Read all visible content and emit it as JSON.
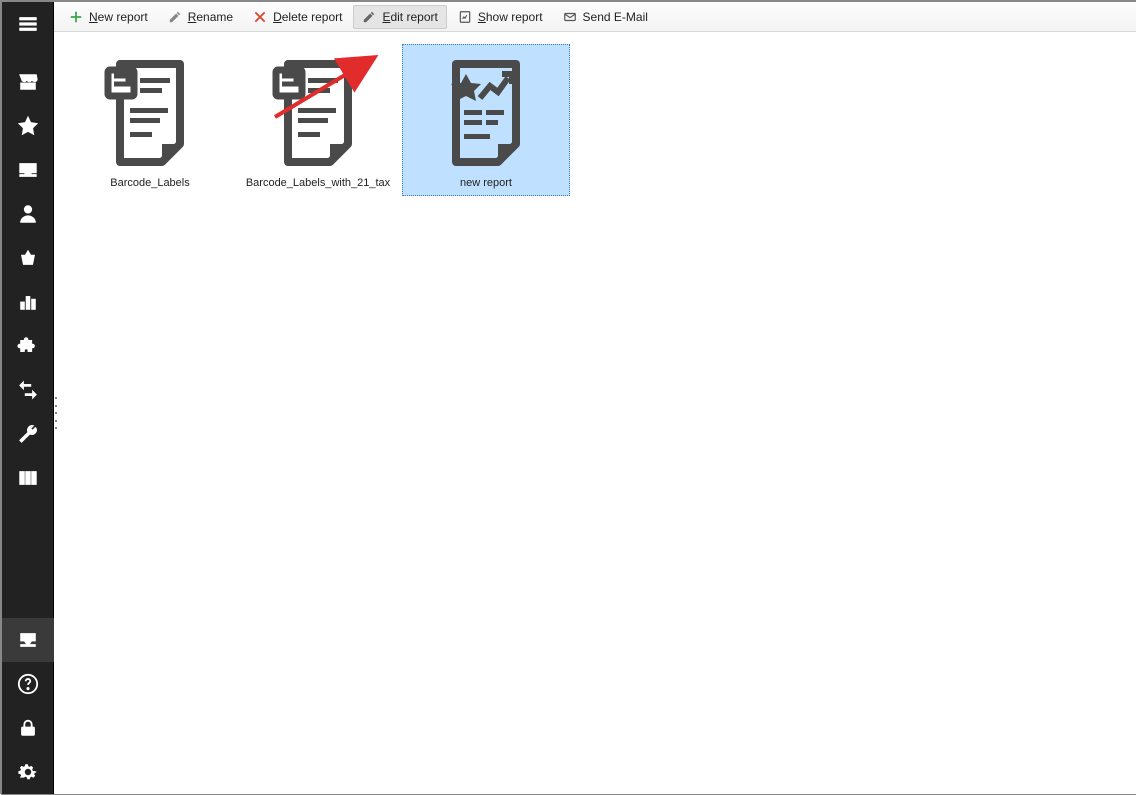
{
  "toolbar": {
    "new_report": "ew report",
    "rename": "ename",
    "delete_report": "elete report",
    "edit_report": "dit report",
    "show_report": "how report",
    "send_email": "Send E-Mail"
  },
  "sidebar_items": [
    {
      "name": "menu-icon"
    },
    {
      "name": "store-icon"
    },
    {
      "name": "star-icon"
    },
    {
      "name": "inbox-icon"
    },
    {
      "name": "person-icon"
    },
    {
      "name": "basket-icon"
    },
    {
      "name": "chart-icon"
    },
    {
      "name": "puzzle-icon"
    },
    {
      "name": "transfer-icon"
    },
    {
      "name": "wrench-icon"
    },
    {
      "name": "columns-icon"
    }
  ],
  "sidebar_bottom": [
    {
      "name": "reports-icon",
      "active": true
    },
    {
      "name": "help-icon"
    },
    {
      "name": "lock-icon"
    },
    {
      "name": "settings-icon"
    }
  ],
  "reports": [
    {
      "label": "Barcode_Labels",
      "kind": "doc",
      "selected": false
    },
    {
      "label": "Barcode_Labels_with_21_tax",
      "kind": "doc",
      "selected": false
    },
    {
      "label": "new report",
      "kind": "chart",
      "selected": true
    }
  ],
  "colors": {
    "selection_bg": "#bfe0ff",
    "selection_border": "#3a7fc4",
    "arrow": "#e22b2b",
    "toolbar_plus": "#3aa648",
    "toolbar_x": "#d9452b",
    "icon_gray": "#4a4a4a"
  }
}
